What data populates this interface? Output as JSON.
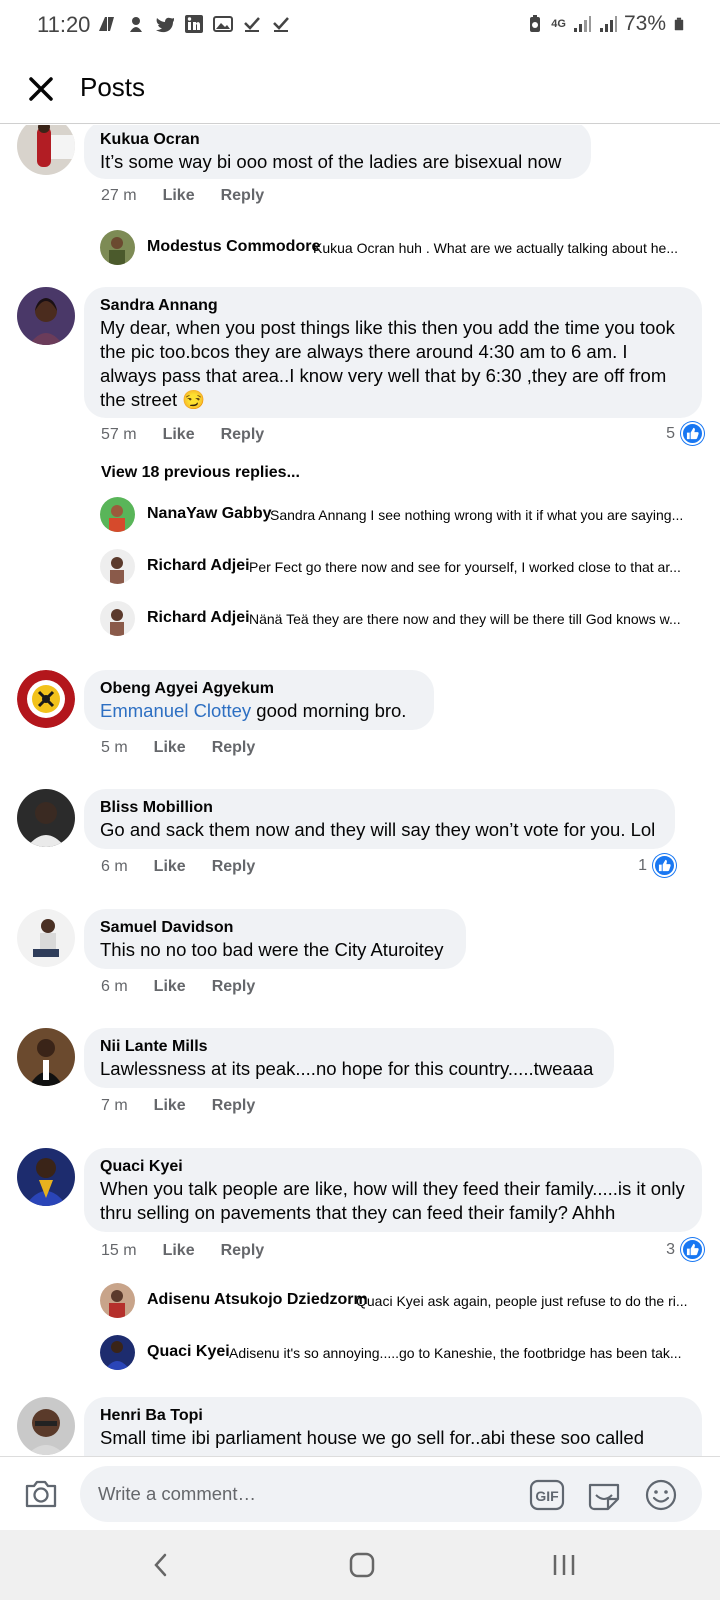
{
  "status_bar": {
    "time": "11:20",
    "network": "4G",
    "battery": "73%"
  },
  "header": {
    "title": "Posts"
  },
  "comments": [
    {
      "name": "Kukua Ocran",
      "text": "It’s some way bi ooo most of the ladies are bisexual now",
      "time": "27 m",
      "like": "Like",
      "reply": "Reply",
      "replies": [
        {
          "name": "Modestus Commodore",
          "text": "Kukua Ocran  huh . What are we actually talking about he..."
        }
      ]
    },
    {
      "name": "Sandra Annang",
      "text": "My dear, when you post things like this then you add the time you took the pic too.bcos they are always there around 4:30 am to 6 am. I always pass that area..I know very well that by 6:30 ,they are off from the street 😏",
      "time": "57 m",
      "like": "Like",
      "reply": "Reply",
      "likes": "5",
      "view_previous": "View 18 previous replies...",
      "replies": [
        {
          "name": "NanaYaw Gabby",
          "text": "Sandra Annang  I see nothing wrong with it if what you are saying..."
        },
        {
          "name": "Richard Adjei",
          "text": "Per Fect go there now and see for yourself, I worked close to that ar..."
        },
        {
          "name": "Richard Adjei",
          "text": "Nänä Teä they are there now and they will be there till God knows w..."
        }
      ]
    },
    {
      "name": "Obeng Agyei Agyekum",
      "mention": "Emmanuel Clottey",
      "text": " good morning bro.",
      "time": "5 m",
      "like": "Like",
      "reply": "Reply"
    },
    {
      "name": "Bliss Mobillion",
      "text": "Go and sack them now and they will say they won’t vote for you. Lol",
      "time": "6 m",
      "like": "Like",
      "reply": "Reply",
      "likes": "1"
    },
    {
      "name": "Samuel Davidson",
      "text": "This no no too bad were the City Aturoitey",
      "time": "6 m",
      "like": "Like",
      "reply": "Reply"
    },
    {
      "name": "Nii Lante Mills",
      "text": "Lawlessness at its peak....no hope for this country.....tweaaa",
      "time": "7 m",
      "like": "Like",
      "reply": "Reply"
    },
    {
      "name": "Quaci Kyei",
      "text": "When you talk people are like, how will they feed their family.....is it only thru selling on pavements that they can feed their family? Ahhh",
      "time": "15 m",
      "like": "Like",
      "reply": "Reply",
      "likes": "3",
      "replies": [
        {
          "name": "Adisenu Atsukojo Dziedzorm",
          "text": "Quaci Kyei ask again, people just refuse to do the ri..."
        },
        {
          "name": "Quaci Kyei",
          "text": "Adisenu it's so annoying.....go to Kaneshie, the footbridge has been tak..."
        }
      ]
    },
    {
      "name": "Henri Ba Topi",
      "text": "Small time ibi parliament house we go sell for..abi these soo called"
    }
  ],
  "composer": {
    "placeholder": "Write a comment…",
    "gif_label": "GIF"
  },
  "colors": {
    "accent": "#1877f2",
    "mention": "#2d6fc2",
    "bubble": "#f0f2f5",
    "meta_text": "#65676b"
  },
  "icons": {
    "close": "close-icon",
    "like_badge": "thumbs-up-icon",
    "camera": "camera-icon",
    "gif": "gif-icon",
    "sticker": "sticker-icon",
    "emoji": "emoji-icon",
    "back": "back-icon",
    "home": "home-icon",
    "recents": "recents-icon"
  }
}
